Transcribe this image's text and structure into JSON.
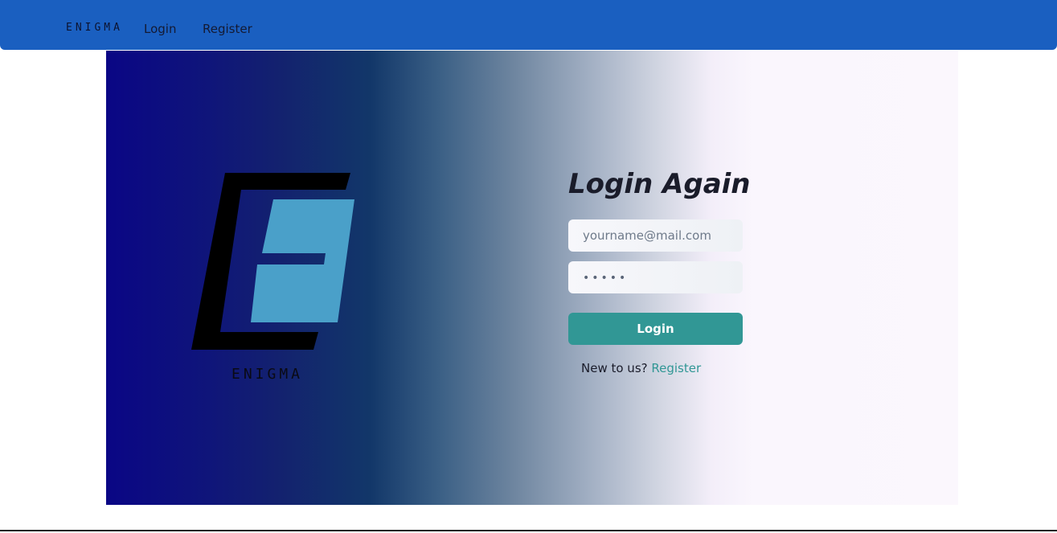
{
  "navbar": {
    "brand": "ENIGMA",
    "links": [
      {
        "label": "Login"
      },
      {
        "label": "Register"
      }
    ]
  },
  "hero": {
    "logo_text": "ENIGMA"
  },
  "login_form": {
    "title": "Login Again",
    "email": {
      "placeholder": "yourname@mail.com",
      "value": ""
    },
    "password": {
      "placeholder": "•••••",
      "value": ""
    },
    "submit_label": "Login",
    "register_prompt": "New to us?",
    "register_link": "Register"
  },
  "colors": {
    "navbar": "#1a5fc0",
    "accent": "#319795",
    "logo_block": "#4aa0c9"
  }
}
